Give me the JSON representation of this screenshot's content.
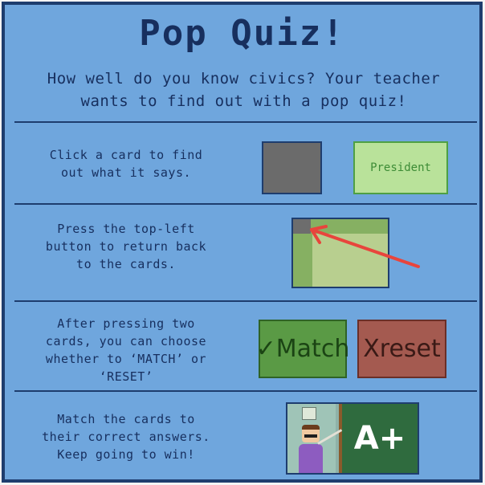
{
  "title": "Pop Quiz!",
  "subtitle_line1": "How well do you know civics? Your teacher",
  "subtitle_line2": "wants to find out with a pop quiz!",
  "steps": [
    {
      "line1": "Click a card to find",
      "line2": "out what it says."
    },
    {
      "line1": "Press the top-left",
      "line2": "button to return back",
      "line3": "to the cards."
    },
    {
      "line1": "After pressing two",
      "line2": "cards, you can choose",
      "line3": "whether to ‘MATCH’ or",
      "line4": "‘RESET’"
    },
    {
      "line1": "Match the cards to",
      "line2": "their correct answers.",
      "line3": "Keep going to win!"
    }
  ],
  "card_word": "President",
  "match_label": "✓Match",
  "reset_label": "Xreset",
  "grade": "A+",
  "colors": {
    "background": "#6fa6dd",
    "border": "#1e3d6e",
    "text": "#172f5e",
    "arrow": "#e8453c"
  }
}
